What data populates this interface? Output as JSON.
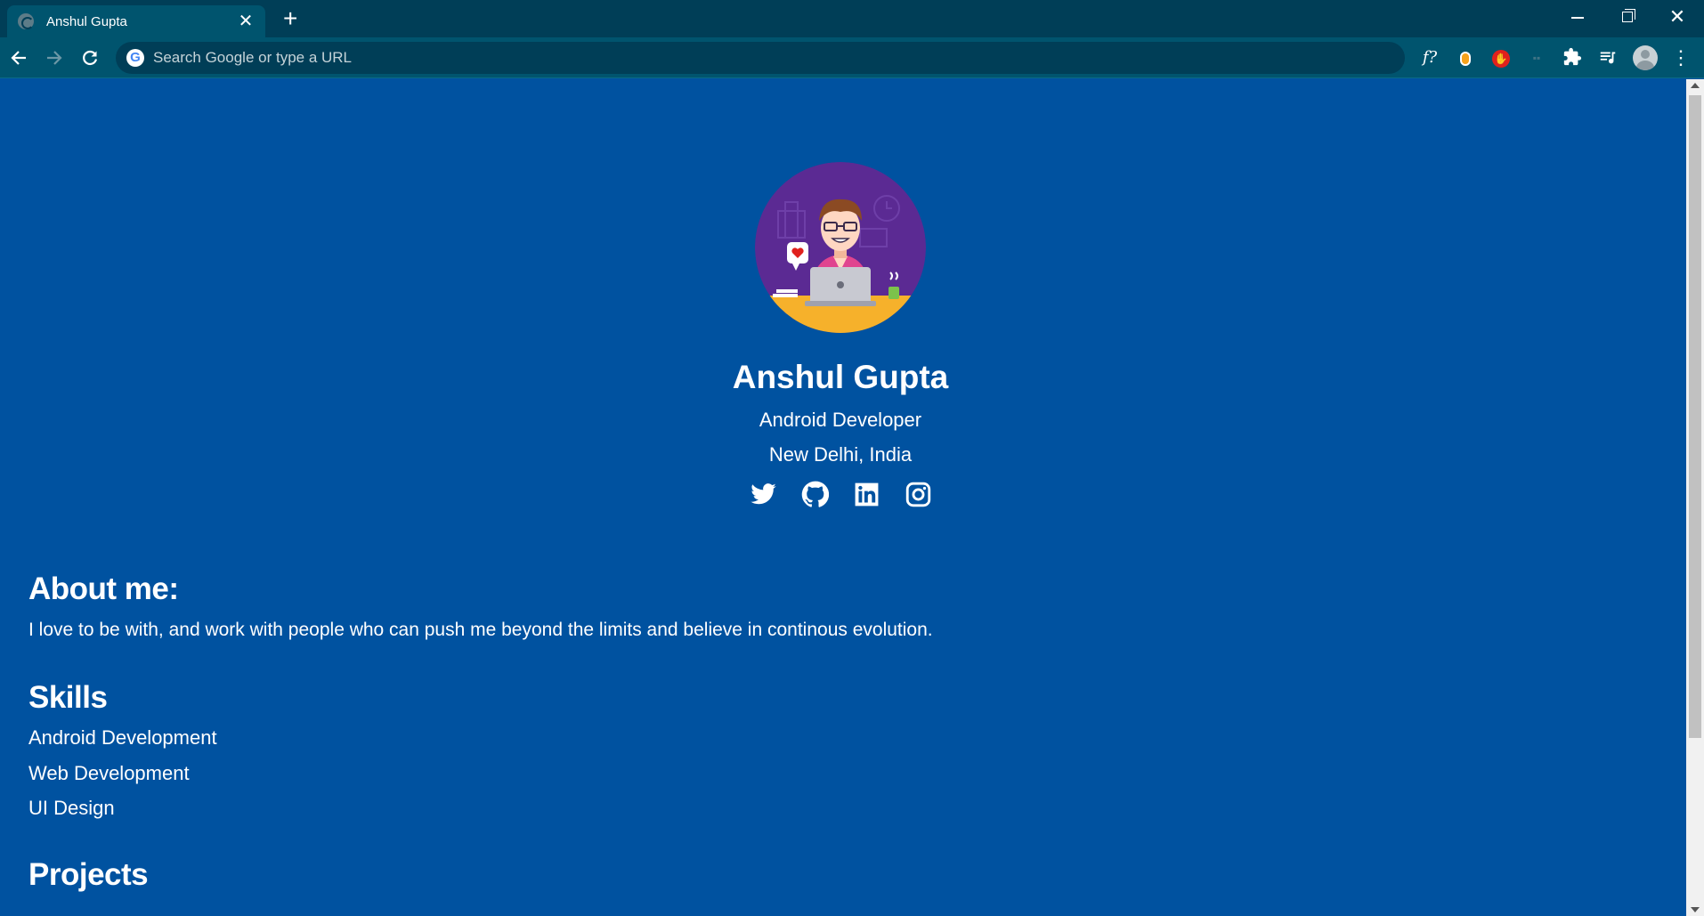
{
  "browser": {
    "tab_title": "Anshul Gupta",
    "tab_close": "✕",
    "new_tab": "+",
    "omnibox_placeholder": "Search Google or type a URL",
    "google_letter": "G",
    "extension_fx": "f?",
    "window": {
      "minimize": "",
      "maximize": "",
      "close": "✕"
    },
    "icons": [
      "back-arrow-icon",
      "forward-arrow-icon",
      "reload-icon",
      "google-icon",
      "fx-extension-icon",
      "pill-extension-icon",
      "stop-extension-icon",
      "dim-extension-icon",
      "puzzle-extension-icon",
      "media-queue-icon",
      "profile-avatar-icon",
      "kebab-menu-icon"
    ]
  },
  "profile": {
    "name": "Anshul Gupta",
    "role": "Android Developer",
    "location": "New Delhi, India",
    "socials": [
      "twitter-icon",
      "github-icon",
      "linkedin-icon",
      "instagram-icon"
    ]
  },
  "about": {
    "heading": "About me:",
    "text": "I love to be with, and work with people who can push me beyond the limits and believe in continous evolution."
  },
  "skills": {
    "heading": "Skills",
    "items": [
      "Android Development",
      "Web Development",
      "UI Design"
    ]
  },
  "projects": {
    "heading": "Projects"
  },
  "colors": {
    "page_bg": "#0052a0",
    "chrome_dark": "#003e57",
    "chrome_tab": "#00546e",
    "avatar_bg": "#5b2a93",
    "desk": "#f6b12b"
  }
}
